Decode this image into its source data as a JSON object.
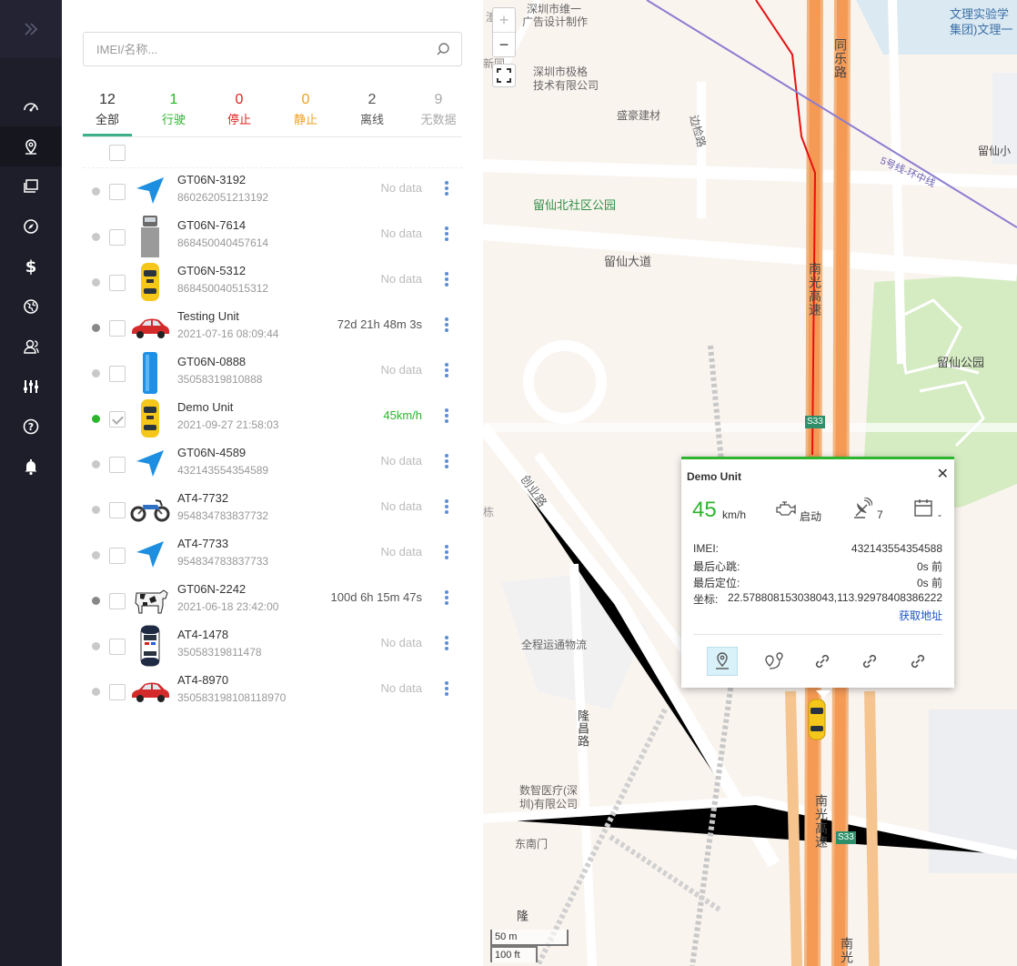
{
  "search": {
    "placeholder": "IMEI/名称..."
  },
  "tabs": [
    {
      "count": "12",
      "label": "全部",
      "color": "#333333"
    },
    {
      "count": "1",
      "label": "行驶",
      "color": "#2bb52b"
    },
    {
      "count": "0",
      "label": "停止",
      "color": "#e02020"
    },
    {
      "count": "0",
      "label": "静止",
      "color": "#f0a020"
    },
    {
      "count": "2",
      "label": "离线",
      "color": "#555555"
    },
    {
      "count": "9",
      "label": "无数据",
      "color": "#aaaaaa"
    }
  ],
  "devices": [
    {
      "name": "GT06N-3192",
      "sub": "860262051213192",
      "status": "No data",
      "icon": "arrow-icon"
    },
    {
      "name": "GT06N-7614",
      "sub": "868450040457614",
      "status": "No data",
      "icon": "truck-icon"
    },
    {
      "name": "GT06N-5312",
      "sub": "868450040515312",
      "status": "No data",
      "icon": "taxi-icon"
    },
    {
      "name": "Testing Unit",
      "sub": "2021-07-16 08:09:44",
      "status": "72d 21h 48m 3s",
      "icon": "red-car-icon"
    },
    {
      "name": "GT06N-0888",
      "sub": "35058319810888",
      "status": "No data",
      "icon": "blue-bar-icon"
    },
    {
      "name": "Demo Unit",
      "sub": "2021-09-27 21:58:03",
      "status": "45km/h",
      "icon": "taxi-icon"
    },
    {
      "name": "GT06N-4589",
      "sub": "432143554354589",
      "status": "No data",
      "icon": "arrow-icon"
    },
    {
      "name": "AT4-7732",
      "sub": "954834783837732",
      "status": "No data",
      "icon": "motorcycle-icon"
    },
    {
      "name": "AT4-7733",
      "sub": "954834783837733",
      "status": "No data",
      "icon": "arrow-icon"
    },
    {
      "name": "GT06N-2242",
      "sub": "2021-06-18 23:42:00",
      "status": "100d 6h 15m 47s",
      "icon": "cow-icon"
    },
    {
      "name": "AT4-1478",
      "sub": "35058319811478",
      "status": "No data",
      "icon": "police-car-icon"
    },
    {
      "name": "AT4-8970",
      "sub": "350583198108118970",
      "status": "No data",
      "icon": "red-car-icon"
    }
  ],
  "map": {
    "labels": {
      "l1": "深圳市维一",
      "l2": "广告设计制作",
      "l3": "深圳市极格",
      "l4": "技术有限公司",
      "l5": "盛豪建材",
      "l6": "边检路",
      "l7": "留仙北社区公园",
      "l8": "留仙大道",
      "l9": "南光高速",
      "l10": "留仙公园",
      "l11": "文理实验学",
      "l12": "集团)文理一",
      "l13": "留仙小",
      "l14": "5号线-环中线",
      "l15": "同乐路",
      "l16": "新同",
      "l17": "全程运通物流",
      "l18": "数智医疗(深",
      "l19": "圳)有限公司",
      "l20": "东南门",
      "l21": "隆昌路",
      "l22": "创业路",
      "l23": "S33",
      "l24": "S33",
      "l25": "南光高速",
      "l26": "南光",
      "l27": "潼",
      "l28": "隆",
      "l29": "栋",
      "l30": "S33"
    },
    "zoom_in": "+",
    "zoom_out": "−",
    "scale_metric": "50 m",
    "scale_imperial": "100 ft"
  },
  "popup": {
    "title": "Demo Unit",
    "close": "✕",
    "speed": "45",
    "speed_unit": "km/h",
    "engine": "启动",
    "satellites": "7",
    "date": "-",
    "imei_label": "IMEI:",
    "imei": "432143554354588",
    "heartbeat_label": "最后心跳:",
    "heartbeat": "0s 前",
    "fix_label": "最后定位:",
    "fix": "0s 前",
    "coord_label": "坐标:",
    "coord": "22.578808153038043,113.92978408386222",
    "address_link": "获取地址"
  },
  "sidebar": {
    "items": [
      "dashboard-icon",
      "location-icon",
      "gallery-icon",
      "compass-icon",
      "dollar-icon",
      "globe-icon",
      "users-icon",
      "sliders-icon",
      "help-icon",
      "bell-icon"
    ]
  }
}
